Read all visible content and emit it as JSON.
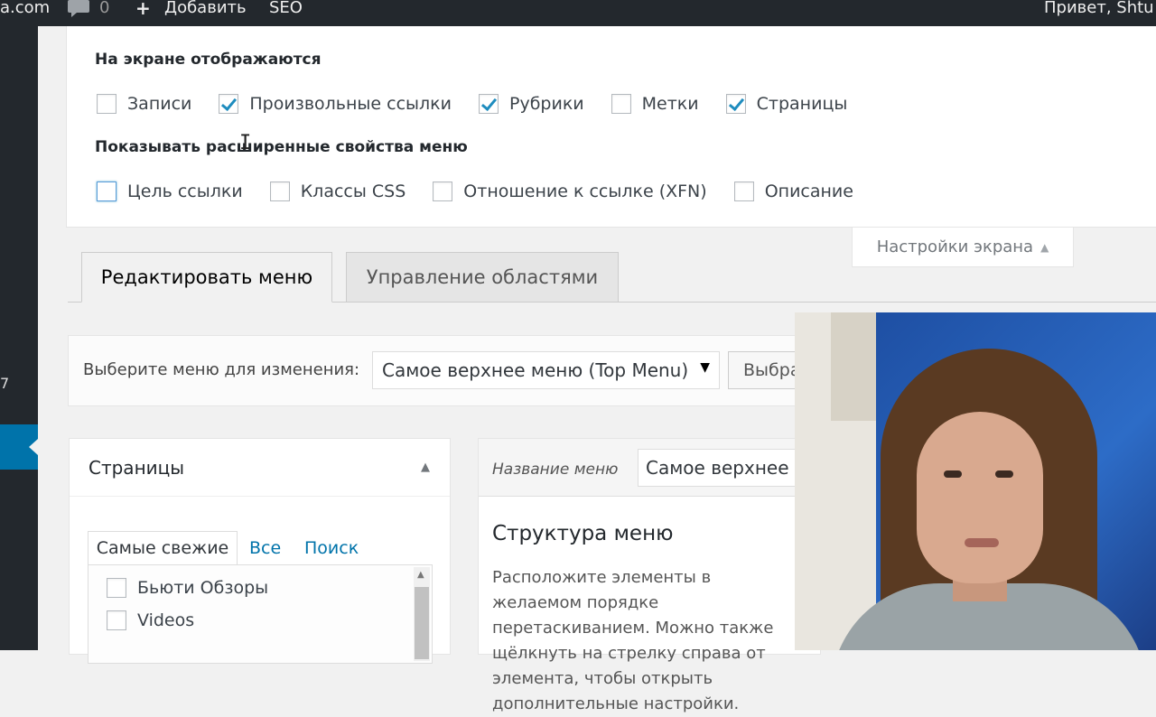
{
  "admin_bar": {
    "site": "a.com",
    "comments_count": "0",
    "add_label": "Добавить",
    "seo_label": "SEO",
    "greeting": "Привет, Shtu"
  },
  "admin_menu": {
    "partial_number": "7"
  },
  "screen_options": {
    "show_on_screen_heading": "На экране отображаются",
    "boxes": [
      {
        "label": "Записи",
        "checked": false
      },
      {
        "label": "Произвольные ссылки",
        "checked": true
      },
      {
        "label": "Рубрики",
        "checked": true
      },
      {
        "label": "Метки",
        "checked": false
      },
      {
        "label": "Страницы",
        "checked": true
      }
    ],
    "advanced_heading": "Показывать расширенные свойства меню",
    "advanced": [
      {
        "label": "Цель ссылки",
        "checked": false
      },
      {
        "label": "Классы CSS",
        "checked": false
      },
      {
        "label": "Отношение к ссылке (XFN)",
        "checked": false
      },
      {
        "label": "Описание",
        "checked": false
      }
    ],
    "toggle_label": "Настройки экрана"
  },
  "nav_tabs": {
    "edit_menu": "Редактировать меню",
    "manage_locations": "Управление областями"
  },
  "select_menu": {
    "label": "Выберите меню для изменения:",
    "selected": "Самое верхнее меню (Top Menu)",
    "button": "Выбрать"
  },
  "pages_box": {
    "title": "Страницы",
    "tabs": {
      "recent": "Самые свежие",
      "all": "Все",
      "search": "Поиск"
    },
    "items": [
      "Бьюти Обзоры",
      "Videos"
    ]
  },
  "menu_box": {
    "name_label": "Название меню",
    "name_value": "Самое верхнее меню (Top Menu)",
    "structure_title": "Структура меню",
    "description": "Расположите элементы в желаемом порядке перетаскиванием. Можно также щёлкнуть на стрелку справа от элемента, чтобы открыть дополнительные настройки."
  }
}
